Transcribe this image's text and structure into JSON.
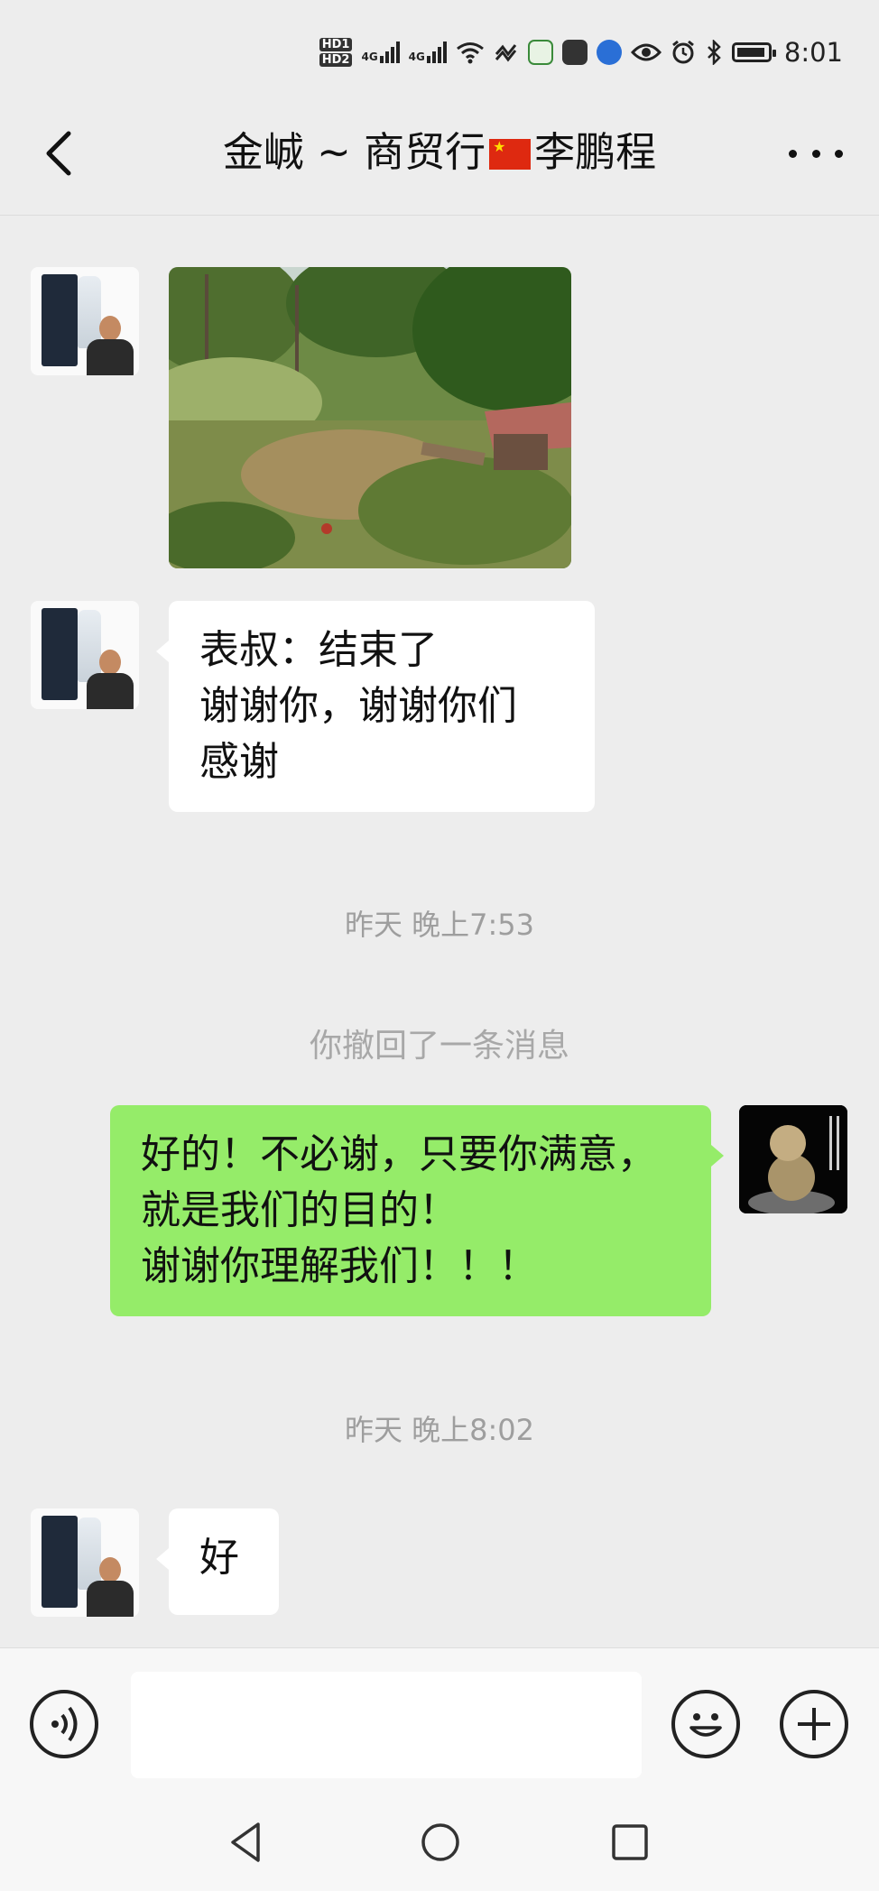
{
  "status_bar": {
    "hd1": "HD1",
    "hd2": "HD2",
    "net1": "4G",
    "net2": "4G",
    "time": "8:01"
  },
  "header": {
    "title_prefix": "金峸 ~ 商贸行",
    "title_suffix": "李鹏程",
    "back_icon": "chevron-left-icon",
    "more_icon": "more-icon"
  },
  "messages": [
    {
      "type": "image",
      "sender": "contact"
    },
    {
      "type": "text",
      "sender": "contact",
      "lines": [
        "表叔：结束了",
        "谢谢你，谢谢你们",
        "感谢"
      ]
    },
    {
      "type": "timestamp",
      "text": "昨天 晚上7:53"
    },
    {
      "type": "system",
      "text": "你撤回了一条消息"
    },
    {
      "type": "text",
      "sender": "me",
      "lines": [
        "好的！不必谢，只要你满意，",
        "就是我们的目的！",
        "谢谢你理解我们！！！"
      ]
    },
    {
      "type": "timestamp",
      "text": "昨天 晚上8:02"
    },
    {
      "type": "text",
      "sender": "contact",
      "lines": [
        "好"
      ]
    }
  ],
  "colors": {
    "background": "#ededed",
    "outgoing_bubble": "#95ec69",
    "incoming_bubble": "#ffffff"
  },
  "input_bar": {
    "voice_icon": "voice-icon",
    "emoji_icon": "emoji-icon",
    "plus_icon": "plus-icon",
    "text_value": ""
  },
  "nav_bar": {
    "back_icon": "nav-back-icon",
    "home_icon": "nav-home-icon",
    "recent_icon": "nav-recent-icon"
  }
}
